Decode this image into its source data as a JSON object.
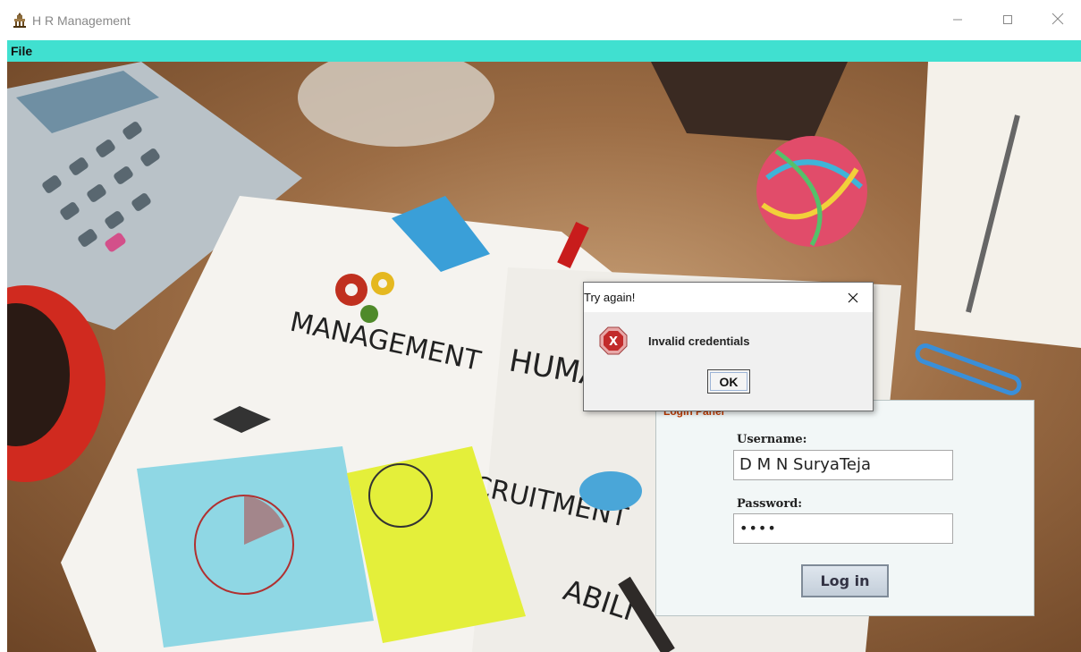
{
  "window": {
    "title": "H R Management"
  },
  "menubar": {
    "file_label": "File",
    "background_color": "#40e0d0"
  },
  "photo_text": {
    "management": "MANAGEMENT",
    "human_resources": "HUMAN RESOURCES",
    "recruitment": "RECRUITMENT",
    "abilities": "ABILI"
  },
  "login_panel": {
    "legend": "Login Panel",
    "username_label": "Username:",
    "username_value": "D M N SuryaTeja",
    "password_label": "Password:",
    "password_mask": "••••",
    "login_button": "Log in"
  },
  "dialog": {
    "title": "Try again!",
    "message": "Invalid credentials",
    "ok_button": "OK",
    "icon": "error-icon"
  }
}
